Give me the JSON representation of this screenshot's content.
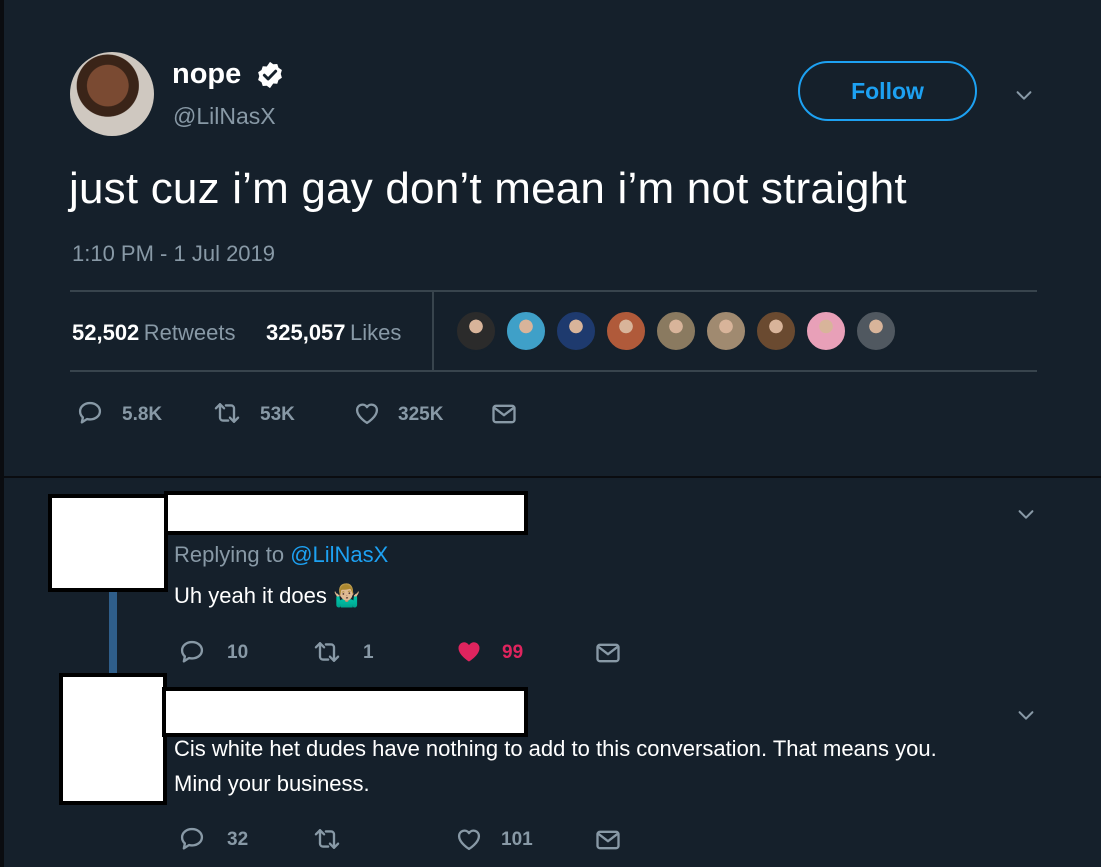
{
  "tweet": {
    "display_name": "nope",
    "handle": "@LilNasX",
    "follow_label": "Follow",
    "text": "just cuz i’m gay don’t mean i’m not straight",
    "timestamp": "1:10 PM - 1 Jul 2019",
    "retweets_count": "52,502",
    "retweets_label": "Retweets",
    "likes_count": "325,057",
    "likes_label": "Likes",
    "likers": [
      "#2b2b2b",
      "#3fa0c8",
      "#1e3a6e",
      "#b05a3a",
      "#8a7a60",
      "#a08a70",
      "#6a4a30",
      "#e8a0b8",
      "#505860"
    ],
    "actions": {
      "replies": "5.8K",
      "retweets": "53K",
      "likes": "325K"
    }
  },
  "replies": [
    {
      "replying_prefix": "Replying to",
      "replying_to": "@LilNasX",
      "text": "Uh yeah it does",
      "emoji": "🤷🏼‍♂️",
      "actions": {
        "replies": "10",
        "retweets": "1",
        "likes": "99"
      },
      "liked": true
    },
    {
      "text_line1": "Cis white het dudes have nothing to add to this conversation. That means you.",
      "text_line2": "Mind your business.",
      "actions": {
        "replies": "32",
        "retweets": "",
        "likes": "101"
      },
      "liked": false
    }
  ],
  "colors": {
    "accent": "#1da1f2",
    "muted": "#8899a6",
    "like": "#e0245e",
    "background": "#15202b"
  },
  "icons": [
    "verified-badge-icon",
    "chevron-down-icon",
    "reply-icon",
    "retweet-icon",
    "heart-icon",
    "message-icon",
    "shrug-emoji"
  ]
}
